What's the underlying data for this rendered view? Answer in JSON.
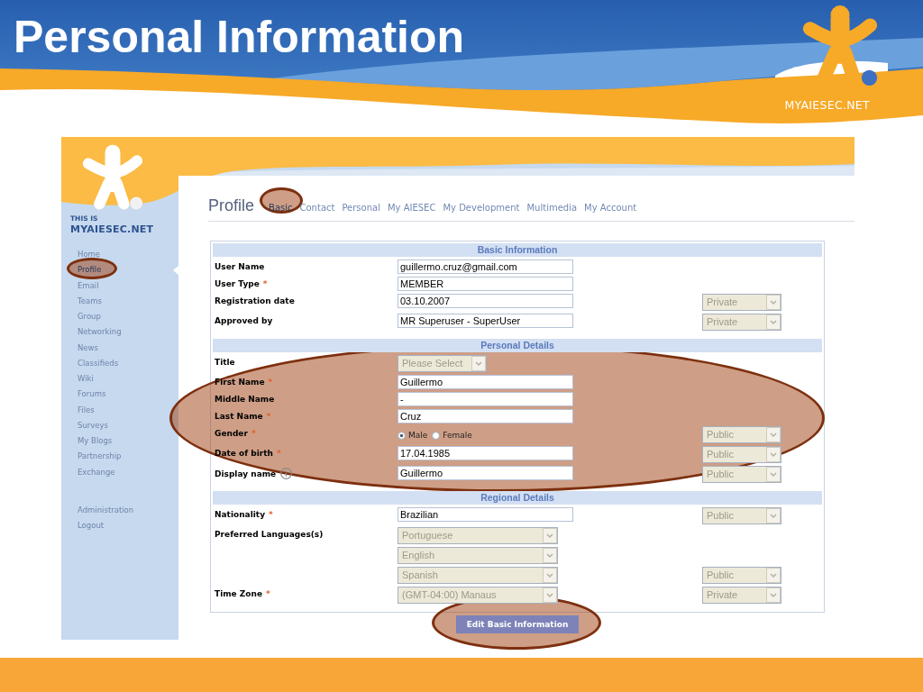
{
  "slide": {
    "title": "Personal Information",
    "logo_text": "MYAIESEC.NET"
  },
  "sidebar": {
    "logo_tagline": "THIS IS",
    "logo_text": "MYAIESEC.NET",
    "items": [
      {
        "label": "Home",
        "selected": false,
        "highlighted": false
      },
      {
        "label": "Profile",
        "selected": true,
        "highlighted": true
      },
      {
        "label": "Email",
        "selected": false,
        "highlighted": false
      },
      {
        "label": "Teams",
        "selected": false,
        "highlighted": false
      },
      {
        "label": "Group",
        "selected": false,
        "highlighted": false
      },
      {
        "label": "Networking",
        "selected": false,
        "highlighted": false
      },
      {
        "label": "News",
        "selected": false,
        "highlighted": false
      },
      {
        "label": "Classifieds",
        "selected": false,
        "highlighted": false
      },
      {
        "label": "Wiki",
        "selected": false,
        "highlighted": false
      },
      {
        "label": "Forums",
        "selected": false,
        "highlighted": false
      },
      {
        "label": "Files",
        "selected": false,
        "highlighted": false
      },
      {
        "label": "Surveys",
        "selected": false,
        "highlighted": false
      },
      {
        "label": "My Blogs",
        "selected": false,
        "highlighted": false
      },
      {
        "label": "Partnership",
        "selected": false,
        "highlighted": false
      },
      {
        "label": "Exchange",
        "selected": false,
        "highlighted": false
      }
    ],
    "footer_items": [
      {
        "label": "Administration",
        "selected": false,
        "highlighted": false
      },
      {
        "label": "Logout",
        "selected": false,
        "highlighted": false
      }
    ]
  },
  "profile": {
    "title": "Profile",
    "tabs": [
      {
        "label": "Basic",
        "highlighted": true
      },
      {
        "label": "Contact",
        "highlighted": false
      },
      {
        "label": "Personal",
        "highlighted": false
      },
      {
        "label": "My AIESEC",
        "highlighted": false
      },
      {
        "label": "My Development",
        "highlighted": false
      },
      {
        "label": "Multimedia",
        "highlighted": false
      },
      {
        "label": "My Account",
        "highlighted": false
      }
    ],
    "sections": [
      {
        "title": "Basic Information",
        "highlighted": false,
        "rows": [
          {
            "kind": "text",
            "label": "User Name",
            "value": "guillermo.cruz@gmail.com",
            "disabled": false
          },
          {
            "kind": "text",
            "label": "User Type",
            "required_mark": "*",
            "value": "MEMBER",
            "disabled": false
          },
          {
            "kind": "text",
            "label": "Registration date",
            "value": "03.10.2007",
            "disabled": false,
            "privacy": {
              "value": "Private",
              "disabled": true
            }
          },
          {
            "kind": "text",
            "label": "Approved by",
            "value": "MR Superuser - SuperUser",
            "disabled": false,
            "privacy": {
              "value": "Private",
              "disabled": true
            }
          }
        ]
      },
      {
        "title": "Personal Details",
        "highlighted": true,
        "rows": [
          {
            "kind": "select",
            "label": "Title",
            "value": "Please Select",
            "disabled": true
          },
          {
            "kind": "text",
            "label": "First Name",
            "required_mark": "*",
            "value": "Guillermo",
            "disabled": false
          },
          {
            "kind": "text",
            "label": "Middle Name",
            "value": "-",
            "disabled": false
          },
          {
            "kind": "text",
            "label": "Last Name",
            "required_mark": "*",
            "value": "Cruz",
            "disabled": false
          },
          {
            "kind": "radio",
            "label": "Gender",
            "required_mark": "*",
            "options": [
              {
                "label": "Male",
                "selected": true
              },
              {
                "label": "Female",
                "selected": false
              }
            ],
            "privacy": {
              "value": "Public",
              "disabled": true
            }
          },
          {
            "kind": "text",
            "label": "Date of birth",
            "required_mark": "*",
            "value": "17.04.1985",
            "disabled": false,
            "privacy": {
              "value": "Public",
              "disabled": true
            }
          },
          {
            "kind": "text",
            "label": "Display name",
            "help_icon": true,
            "value": "Guillermo",
            "disabled": false,
            "privacy": {
              "value": "Public",
              "disabled": true
            }
          }
        ]
      },
      {
        "title": "Regional Details",
        "highlighted": false,
        "rows": [
          {
            "kind": "text",
            "label": "Nationality",
            "required_mark": "*",
            "value": "Brazilian",
            "disabled": false,
            "privacy": {
              "value": "Public",
              "disabled": true
            }
          },
          {
            "kind": "select-list",
            "label": "Preferred Languages(s)",
            "options": [
              {
                "value": "Portuguese",
                "disabled": true
              },
              {
                "value": "English",
                "disabled": true
              },
              {
                "value": "Spanish",
                "disabled": true,
                "privacy": {
                  "value": "Public",
                  "disabled": true
                }
              }
            ]
          },
          {
            "kind": "select",
            "label": "Time Zone",
            "required_mark": "*",
            "value": "(GMT-04:00) Manaus",
            "disabled": true,
            "privacy": {
              "value": "Private",
              "disabled": true
            }
          }
        ]
      }
    ],
    "edit_button": {
      "label": "Edit Basic Information",
      "highlighted": true
    }
  }
}
